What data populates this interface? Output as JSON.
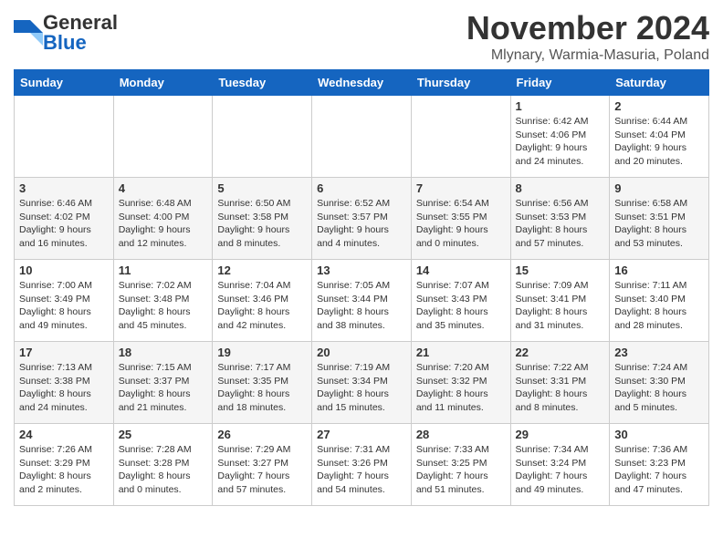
{
  "logo": {
    "general": "General",
    "blue": "Blue"
  },
  "title": "November 2024",
  "subtitle": "Mlynary, Warmia-Masuria, Poland",
  "days_of_week": [
    "Sunday",
    "Monday",
    "Tuesday",
    "Wednesday",
    "Thursday",
    "Friday",
    "Saturday"
  ],
  "weeks": [
    [
      {
        "day": "",
        "info": ""
      },
      {
        "day": "",
        "info": ""
      },
      {
        "day": "",
        "info": ""
      },
      {
        "day": "",
        "info": ""
      },
      {
        "day": "",
        "info": ""
      },
      {
        "day": "1",
        "info": "Sunrise: 6:42 AM\nSunset: 4:06 PM\nDaylight: 9 hours and 24 minutes."
      },
      {
        "day": "2",
        "info": "Sunrise: 6:44 AM\nSunset: 4:04 PM\nDaylight: 9 hours and 20 minutes."
      }
    ],
    [
      {
        "day": "3",
        "info": "Sunrise: 6:46 AM\nSunset: 4:02 PM\nDaylight: 9 hours and 16 minutes."
      },
      {
        "day": "4",
        "info": "Sunrise: 6:48 AM\nSunset: 4:00 PM\nDaylight: 9 hours and 12 minutes."
      },
      {
        "day": "5",
        "info": "Sunrise: 6:50 AM\nSunset: 3:58 PM\nDaylight: 9 hours and 8 minutes."
      },
      {
        "day": "6",
        "info": "Sunrise: 6:52 AM\nSunset: 3:57 PM\nDaylight: 9 hours and 4 minutes."
      },
      {
        "day": "7",
        "info": "Sunrise: 6:54 AM\nSunset: 3:55 PM\nDaylight: 9 hours and 0 minutes."
      },
      {
        "day": "8",
        "info": "Sunrise: 6:56 AM\nSunset: 3:53 PM\nDaylight: 8 hours and 57 minutes."
      },
      {
        "day": "9",
        "info": "Sunrise: 6:58 AM\nSunset: 3:51 PM\nDaylight: 8 hours and 53 minutes."
      }
    ],
    [
      {
        "day": "10",
        "info": "Sunrise: 7:00 AM\nSunset: 3:49 PM\nDaylight: 8 hours and 49 minutes."
      },
      {
        "day": "11",
        "info": "Sunrise: 7:02 AM\nSunset: 3:48 PM\nDaylight: 8 hours and 45 minutes."
      },
      {
        "day": "12",
        "info": "Sunrise: 7:04 AM\nSunset: 3:46 PM\nDaylight: 8 hours and 42 minutes."
      },
      {
        "day": "13",
        "info": "Sunrise: 7:05 AM\nSunset: 3:44 PM\nDaylight: 8 hours and 38 minutes."
      },
      {
        "day": "14",
        "info": "Sunrise: 7:07 AM\nSunset: 3:43 PM\nDaylight: 8 hours and 35 minutes."
      },
      {
        "day": "15",
        "info": "Sunrise: 7:09 AM\nSunset: 3:41 PM\nDaylight: 8 hours and 31 minutes."
      },
      {
        "day": "16",
        "info": "Sunrise: 7:11 AM\nSunset: 3:40 PM\nDaylight: 8 hours and 28 minutes."
      }
    ],
    [
      {
        "day": "17",
        "info": "Sunrise: 7:13 AM\nSunset: 3:38 PM\nDaylight: 8 hours and 24 minutes."
      },
      {
        "day": "18",
        "info": "Sunrise: 7:15 AM\nSunset: 3:37 PM\nDaylight: 8 hours and 21 minutes."
      },
      {
        "day": "19",
        "info": "Sunrise: 7:17 AM\nSunset: 3:35 PM\nDaylight: 8 hours and 18 minutes."
      },
      {
        "day": "20",
        "info": "Sunrise: 7:19 AM\nSunset: 3:34 PM\nDaylight: 8 hours and 15 minutes."
      },
      {
        "day": "21",
        "info": "Sunrise: 7:20 AM\nSunset: 3:32 PM\nDaylight: 8 hours and 11 minutes."
      },
      {
        "day": "22",
        "info": "Sunrise: 7:22 AM\nSunset: 3:31 PM\nDaylight: 8 hours and 8 minutes."
      },
      {
        "day": "23",
        "info": "Sunrise: 7:24 AM\nSunset: 3:30 PM\nDaylight: 8 hours and 5 minutes."
      }
    ],
    [
      {
        "day": "24",
        "info": "Sunrise: 7:26 AM\nSunset: 3:29 PM\nDaylight: 8 hours and 2 minutes."
      },
      {
        "day": "25",
        "info": "Sunrise: 7:28 AM\nSunset: 3:28 PM\nDaylight: 8 hours and 0 minutes."
      },
      {
        "day": "26",
        "info": "Sunrise: 7:29 AM\nSunset: 3:27 PM\nDaylight: 7 hours and 57 minutes."
      },
      {
        "day": "27",
        "info": "Sunrise: 7:31 AM\nSunset: 3:26 PM\nDaylight: 7 hours and 54 minutes."
      },
      {
        "day": "28",
        "info": "Sunrise: 7:33 AM\nSunset: 3:25 PM\nDaylight: 7 hours and 51 minutes."
      },
      {
        "day": "29",
        "info": "Sunrise: 7:34 AM\nSunset: 3:24 PM\nDaylight: 7 hours and 49 minutes."
      },
      {
        "day": "30",
        "info": "Sunrise: 7:36 AM\nSunset: 3:23 PM\nDaylight: 7 hours and 47 minutes."
      }
    ]
  ]
}
